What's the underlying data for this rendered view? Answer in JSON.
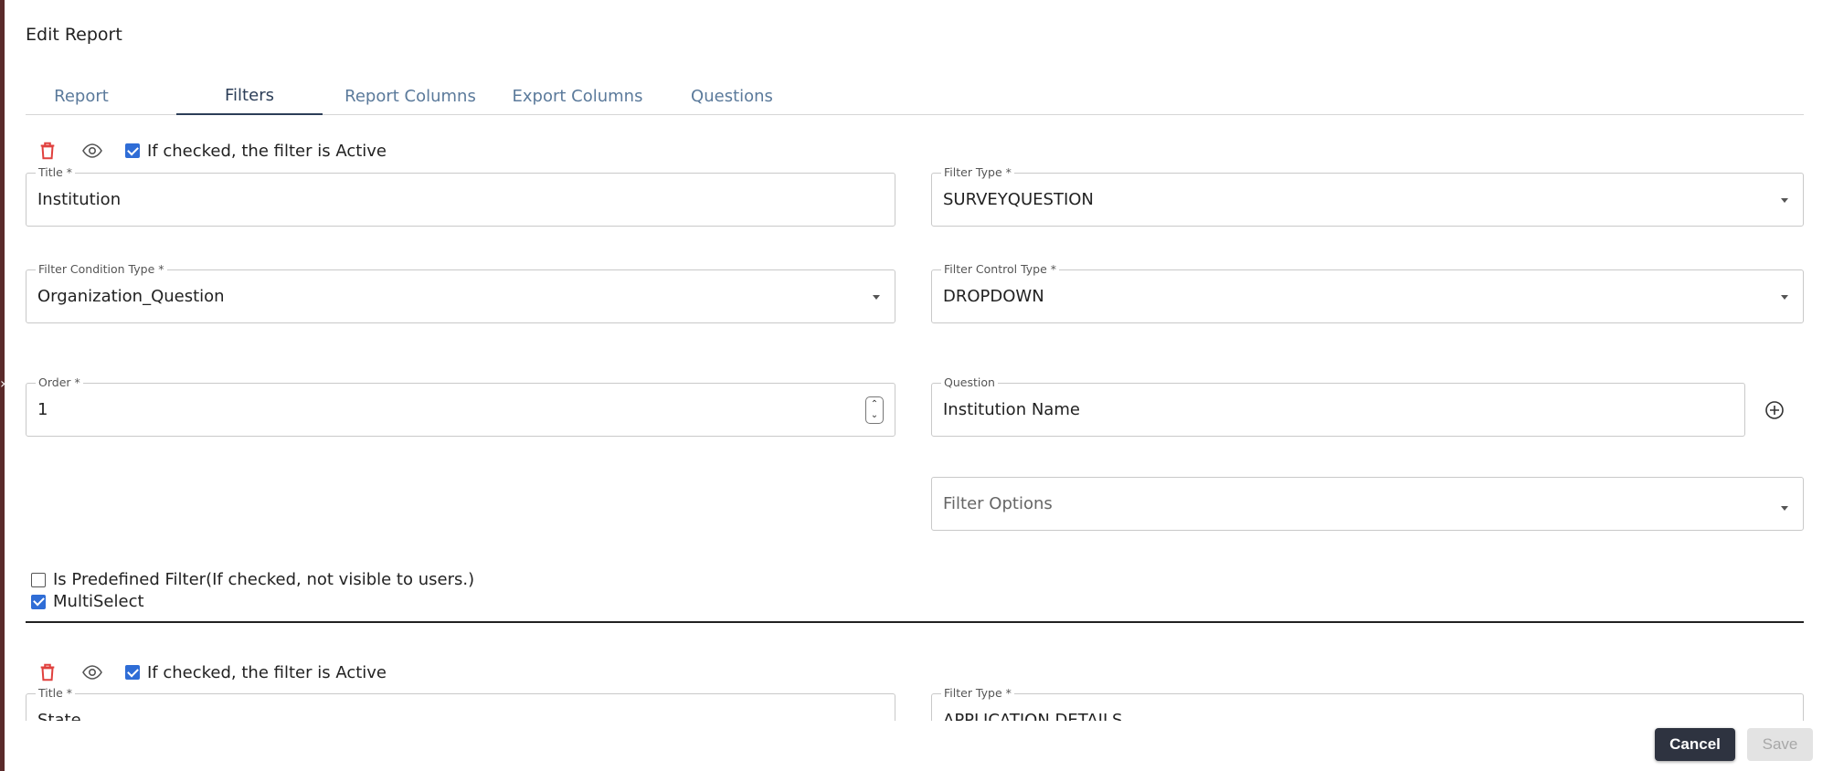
{
  "dialog": {
    "title": "Edit Report",
    "tabs": [
      {
        "label": "Report",
        "active": false
      },
      {
        "label": "Filters",
        "active": true
      },
      {
        "label": "Report Columns",
        "active": false
      },
      {
        "label": "Export Columns",
        "active": false
      },
      {
        "label": "Questions",
        "active": false
      }
    ]
  },
  "filters": [
    {
      "active_checked": true,
      "active_label": "If checked, the filter is Active",
      "title": {
        "label": "Title *",
        "value": "Institution"
      },
      "filter_type": {
        "label": "Filter Type *",
        "value": "SURVEYQUESTION"
      },
      "condition_type": {
        "label": "Filter Condition Type *",
        "value": "Organization_Question"
      },
      "control_type": {
        "label": "Filter Control Type *",
        "value": "DROPDOWN"
      },
      "order": {
        "label": "Order *",
        "value": "1"
      },
      "question": {
        "label": "Question",
        "value": "Institution Name"
      },
      "filter_options": {
        "placeholder": "Filter Options"
      },
      "predefined": {
        "checked": false,
        "label": "Is Predefined Filter(If checked, not visible to users.)"
      },
      "multiselect": {
        "checked": true,
        "label": "MultiSelect"
      }
    },
    {
      "active_checked": true,
      "active_label": "If checked, the filter is Active",
      "title": {
        "label": "Title *",
        "value": "State"
      },
      "filter_type": {
        "label": "Filter Type *",
        "value": "APPLICATION DETAILS"
      }
    }
  ],
  "footer": {
    "cancel_label": "Cancel",
    "save_label": "Save"
  },
  "colors": {
    "accent": "#2f6dd6",
    "delete": "#e0413e",
    "tab_active": "#2c3e58",
    "tab_inactive": "#5b7a9b",
    "cancel_bg": "#2e3340"
  }
}
